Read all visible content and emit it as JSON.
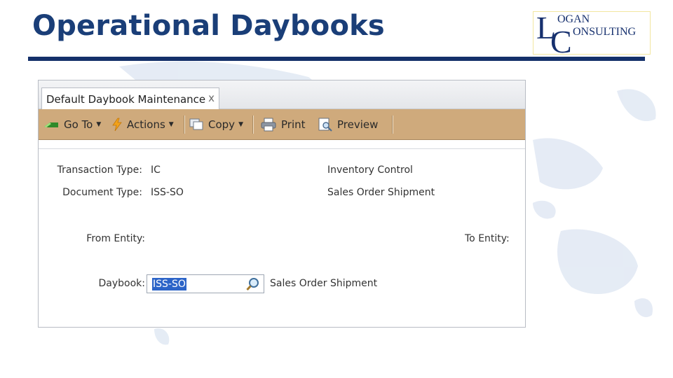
{
  "slide": {
    "title": "Operational Daybooks",
    "logo": {
      "line1_initial": "L",
      "line1_rest": "OGAN",
      "line2_initial": "C",
      "line2_rest": "ONSULTING"
    }
  },
  "window": {
    "tab_label": "Default Daybook Maintenance",
    "tab_close_glyph": "x",
    "toolbar": {
      "goto_label": "Go To",
      "actions_label": "Actions",
      "copy_label": "Copy",
      "print_label": "Print",
      "preview_label": "Preview"
    }
  },
  "form": {
    "transaction_type": {
      "label": "Transaction Type:",
      "value": "IC",
      "description": "Inventory Control"
    },
    "document_type": {
      "label": "Document Type:",
      "value": "ISS-SO",
      "description": "Sales Order Shipment"
    },
    "from_entity_label": "From Entity:",
    "to_entity_label": "To Entity:",
    "daybook": {
      "label": "Daybook:",
      "value": "ISS-SO",
      "description": "Sales Order Shipment"
    }
  },
  "colors": {
    "title": "#1a3e78",
    "rule": "#14306a",
    "toolbar": "#cfaa7c",
    "selection": "#2c64c8"
  }
}
